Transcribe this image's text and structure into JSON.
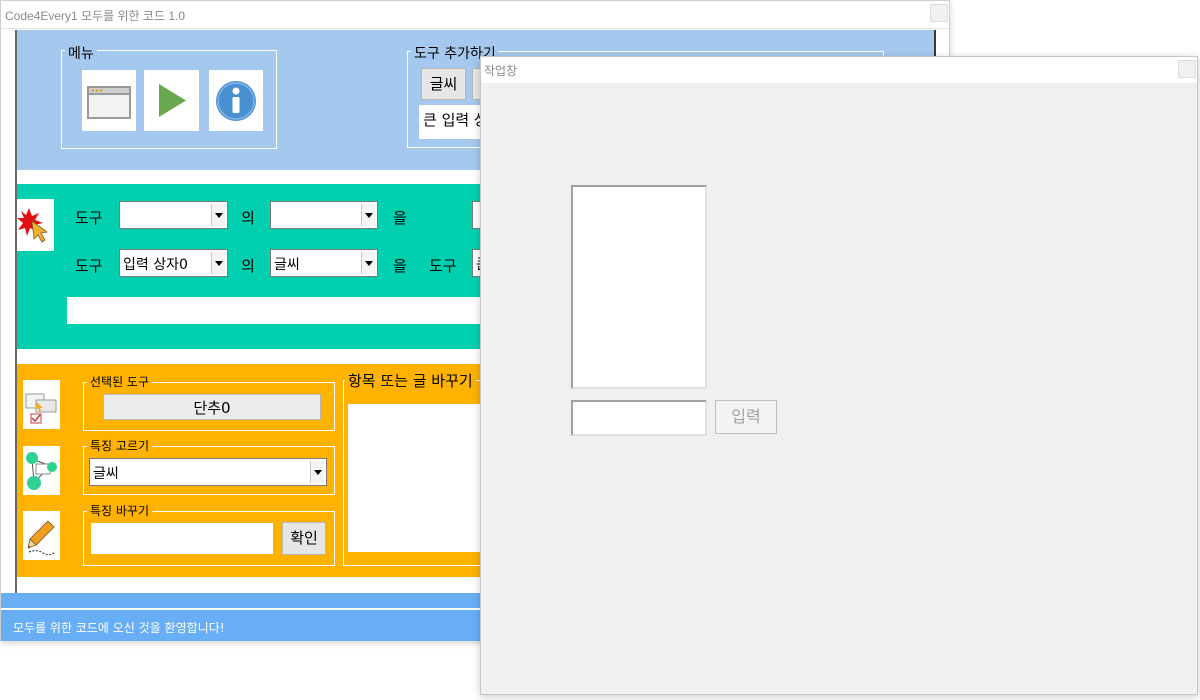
{
  "main_window": {
    "title": "Code4Every1 모두를 위한 코드 1.0",
    "menu": {
      "label": "메뉴",
      "buttons": [
        {
          "icon": "window-icon"
        },
        {
          "icon": "play-icon"
        },
        {
          "icon": "info-icon"
        }
      ]
    },
    "add_tools": {
      "label": "도구 추가하기",
      "text_button": "글씨",
      "big_input_button": "큰 입력 상"
    },
    "event_rows": [
      {
        "tool_label": "도구",
        "combo1": "",
        "of_label": "의",
        "combo2": "",
        "eul_label": "을"
      },
      {
        "tool_label": "도구",
        "combo1": "입력 상자0",
        "of_label": "의",
        "combo2": "글씨",
        "eul_label": "을",
        "tool_label2": "도구",
        "partial": "큰"
      }
    ],
    "selected_tool": {
      "label": "선택된 도구",
      "value": "단추0"
    },
    "choose_feature": {
      "label": "특징 고르기",
      "value": "글씨"
    },
    "change_feature": {
      "label": "특징 바꾸기",
      "input": "",
      "confirm": "확인"
    },
    "change_items": {
      "label": "항목 또는 글 바꾸기"
    },
    "status_bar": "모두를 위한 코드에 오신 것을 환영합니다!",
    "colors": {
      "menu_panel": "#a5c9ee",
      "event_panel": "#00d0b0",
      "props_panel": "#ffb300",
      "status_bar": "#68aef5"
    }
  },
  "work_window": {
    "title": "작업창",
    "input_value": "",
    "input_button": "입력"
  }
}
